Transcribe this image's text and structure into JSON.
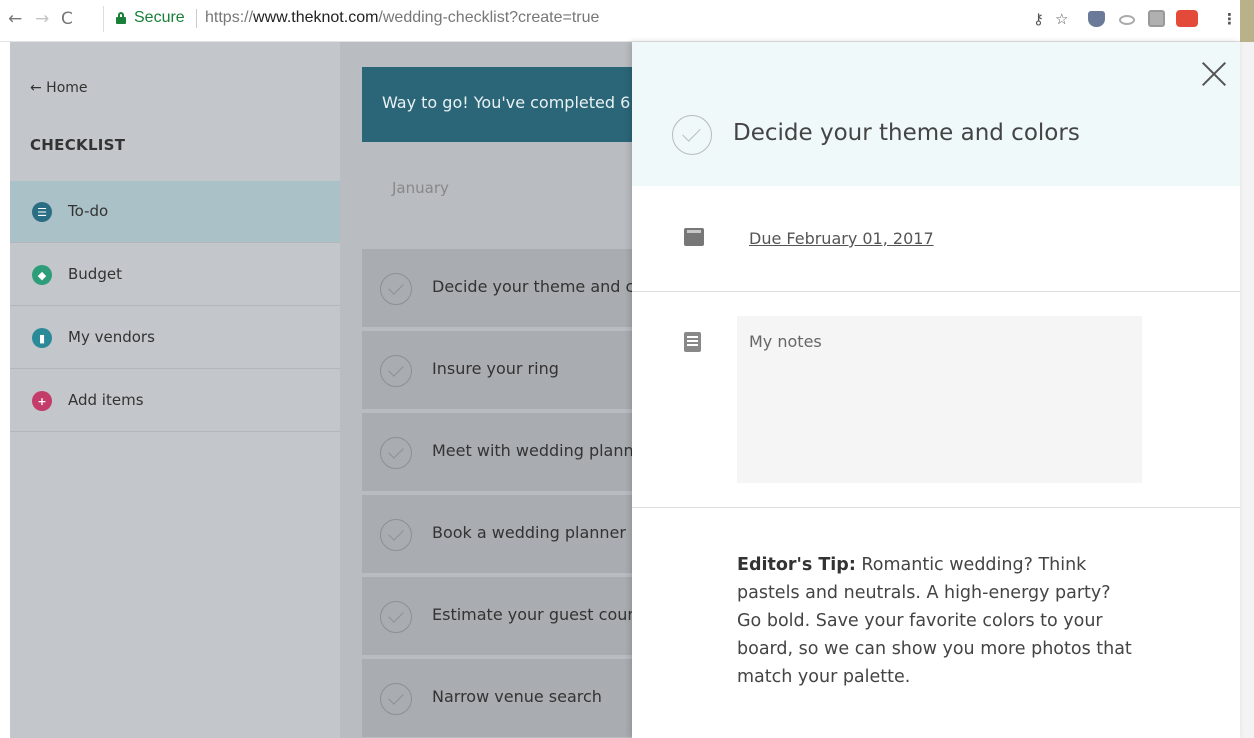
{
  "browser": {
    "back": "←",
    "forward": "→",
    "reload": "C",
    "secure_label": "Secure",
    "url_scheme": "https://",
    "url_host": "www.theknot.com",
    "url_path": "/wedding-checklist?create=true",
    "menu": "⋮"
  },
  "sidebar": {
    "home_link": "← Home",
    "title": "CHECKLIST",
    "items": [
      {
        "label": "To-do",
        "icon": "list-icon",
        "color": "#2b6e84"
      },
      {
        "label": "Budget",
        "icon": "tag-icon",
        "color": "#2e9e7a"
      },
      {
        "label": "My vendors",
        "icon": "bookmark-icon",
        "color": "#2b8a98"
      },
      {
        "label": "Add items",
        "icon": "plus-icon",
        "color": "#c33c6a"
      }
    ]
  },
  "main": {
    "banner": "Way to go! You've completed 6",
    "month": "January",
    "tasks": [
      "Decide your theme and colors",
      "Insure your ring",
      "Meet with wedding planners",
      "Book a wedding planner",
      "Estimate your guest count",
      "Narrow venue search"
    ]
  },
  "panel": {
    "title": "Decide your theme and colors",
    "due": "Due February 01, 2017",
    "notes_placeholder": "My notes",
    "tip_label": "Editor's Tip:",
    "tip_text": " Romantic wedding? Think pastels and neutrals. A high-energy party? Go bold. Save your favorite colors to your board, so we can show you more photos that match your palette."
  },
  "colors": {
    "accent": "#2b6678",
    "panel_header": "#eff9f9"
  }
}
